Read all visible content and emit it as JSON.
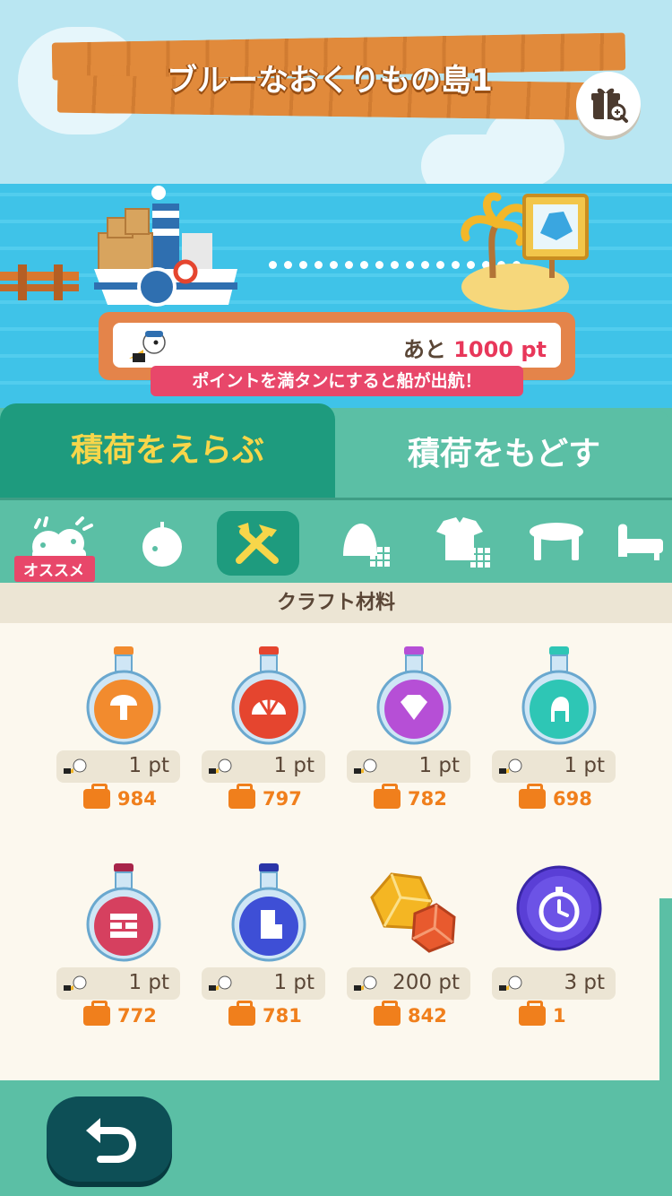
{
  "header": {
    "title": "ブルーなおくりもの島1",
    "gift_icon": "gift-zoom-icon"
  },
  "voyage": {
    "remaining_prefix": "あと",
    "remaining_points": "1000",
    "remaining_unit": "pt",
    "banner": "ポイントを満タンにすると船が出航！"
  },
  "tabs": [
    {
      "label": "積荷をえらぶ",
      "active": true
    },
    {
      "label": "積荷をもどす",
      "active": false
    }
  ],
  "categories": {
    "recommended_badge": "オススメ",
    "items": [
      "recommended-icon",
      "fruit-icon",
      "craft-tools-icon",
      "bell-grid-icon",
      "clothes-grid-icon",
      "table-icon",
      "bed-icon"
    ],
    "active_index": 2
  },
  "section_title": "クラフト材料",
  "items": [
    {
      "icon": "orange-mushroom-bottle-icon",
      "points": "1 pt",
      "stock": "984",
      "color": "#f28b2e"
    },
    {
      "icon": "red-shell-bottle-icon",
      "points": "1 pt",
      "stock": "797",
      "color": "#e5452f"
    },
    {
      "icon": "purple-gem-bottle-icon",
      "points": "1 pt",
      "stock": "782",
      "color": "#b64fd6"
    },
    {
      "icon": "teal-chair-bottle-icon",
      "points": "1 pt",
      "stock": "698",
      "color": "#2ec6b5"
    },
    {
      "icon": "pink-brick-bottle-icon",
      "points": "1 pt",
      "stock": "772",
      "color": "#d6405f"
    },
    {
      "icon": "blue-building-bottle-icon",
      "points": "1 pt",
      "stock": "781",
      "color": "#3e4fd6"
    },
    {
      "icon": "gem-ore-icon",
      "points": "200 pt",
      "stock": "842",
      "color": "#f4b623"
    },
    {
      "icon": "stopwatch-gem-icon",
      "points": "3 pt",
      "stock": "1",
      "color": "#5a3fd6"
    }
  ]
}
